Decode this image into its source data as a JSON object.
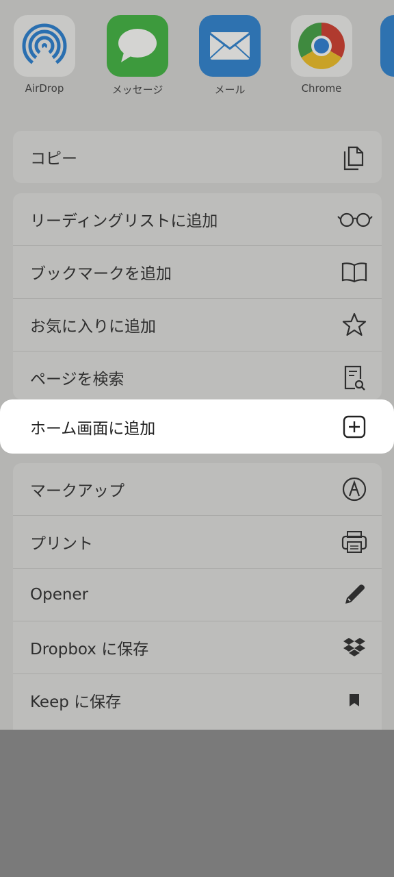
{
  "apps": [
    {
      "label": "AirDrop",
      "icon": "airdrop-icon"
    },
    {
      "label": "メッセージ",
      "icon": "messages-icon"
    },
    {
      "label": "メール",
      "icon": "mail-icon"
    },
    {
      "label": "Chrome",
      "icon": "chrome-icon"
    }
  ],
  "copy_group": {
    "items": [
      {
        "label": "コピー",
        "icon": "copy-icon"
      }
    ]
  },
  "browser_group": {
    "items": [
      {
        "label": "リーディングリストに追加",
        "icon": "glasses-icon"
      },
      {
        "label": "ブックマークを追加",
        "icon": "book-icon"
      },
      {
        "label": "お気に入りに追加",
        "icon": "star-icon"
      },
      {
        "label": "ページを検索",
        "icon": "find-on-page-icon"
      }
    ]
  },
  "highlighted_item": {
    "label": "ホーム画面に追加",
    "icon": "add-square-icon"
  },
  "extensions_group": {
    "items": [
      {
        "label": "マークアップ",
        "icon": "markup-icon"
      },
      {
        "label": "プリント",
        "icon": "printer-icon"
      },
      {
        "label": "Opener",
        "icon": "pencil-icon"
      },
      {
        "label": "Dropbox に保存",
        "icon": "dropbox-icon"
      },
      {
        "label": "Keep に保存",
        "icon": "bookmark-icon"
      }
    ]
  }
}
